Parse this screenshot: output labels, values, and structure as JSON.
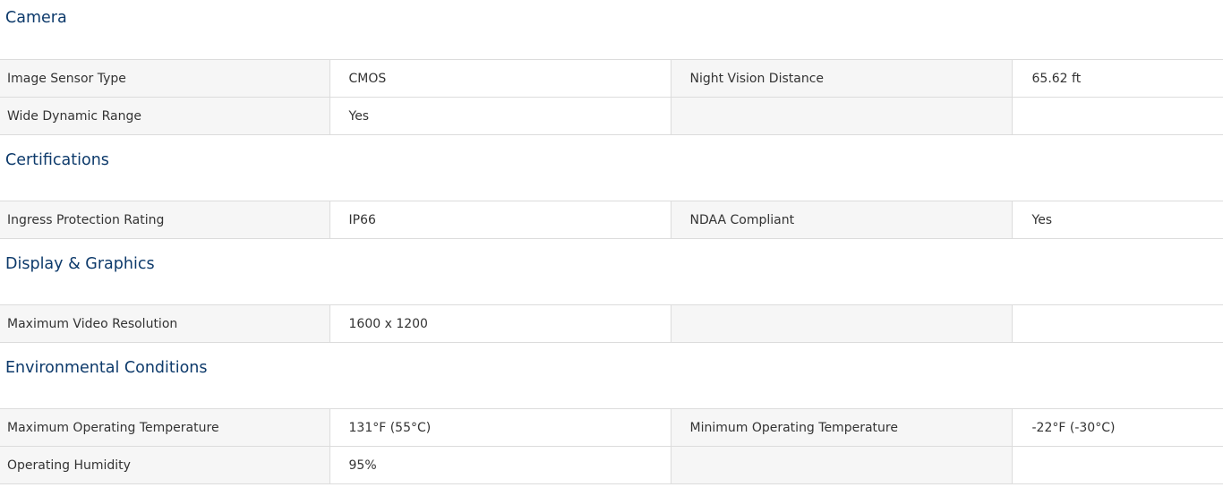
{
  "sections": [
    {
      "title": "Camera",
      "rows": [
        [
          "Image Sensor Type",
          "CMOS",
          "Night Vision Distance",
          "65.62 ft"
        ],
        [
          "Wide Dynamic Range",
          "Yes",
          "",
          ""
        ]
      ]
    },
    {
      "title": "Certifications",
      "rows": [
        [
          "Ingress Protection Rating",
          "IP66",
          "NDAA Compliant",
          "Yes"
        ]
      ]
    },
    {
      "title": "Display & Graphics",
      "rows": [
        [
          "Maximum Video Resolution",
          "1600 x 1200",
          "",
          ""
        ]
      ]
    },
    {
      "title": "Environmental Conditions",
      "rows": [
        [
          "Maximum Operating Temperature",
          "131°F (55°C)",
          "Minimum Operating Temperature",
          "-22°F (-30°C)"
        ],
        [
          "Operating Humidity",
          "95%",
          "",
          ""
        ]
      ]
    }
  ]
}
